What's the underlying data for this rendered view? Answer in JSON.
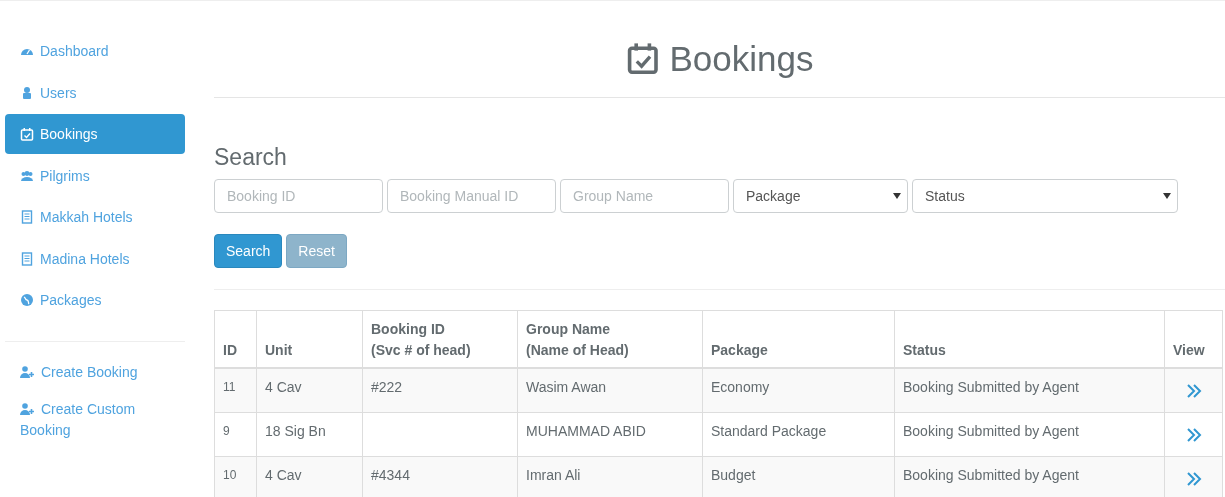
{
  "sidebar": {
    "items": [
      {
        "label": "Dashboard",
        "selected": false
      },
      {
        "label": "Users",
        "selected": false
      },
      {
        "label": "Bookings",
        "selected": true
      },
      {
        "label": "Pilgrims",
        "selected": false
      },
      {
        "label": "Makkah Hotels",
        "selected": false
      },
      {
        "label": "Madina Hotels",
        "selected": false
      },
      {
        "label": "Packages",
        "selected": false
      }
    ],
    "actions": [
      {
        "label": "Create Booking"
      },
      {
        "label": "Create Custom Booking"
      }
    ]
  },
  "page_title": "Bookings",
  "search": {
    "title": "Search",
    "filters": [
      {
        "kind": "text",
        "placeholder": "Booking ID"
      },
      {
        "kind": "text",
        "placeholder": "Booking Manual ID"
      },
      {
        "kind": "text",
        "placeholder": "Group Name"
      },
      {
        "kind": "select",
        "value": "Package"
      },
      {
        "kind": "select",
        "value": "Status"
      }
    ],
    "buttons": [
      {
        "label": "Search",
        "kind": "primary"
      },
      {
        "label": "Reset",
        "kind": "secondary"
      }
    ]
  },
  "table": {
    "columns": [
      {
        "label": "ID"
      },
      {
        "label": "Unit"
      },
      {
        "label": "Booking ID\n(Svc # of head)"
      },
      {
        "label": "Group Name\n(Name of Head)"
      },
      {
        "label": "Package"
      },
      {
        "label": "Status"
      },
      {
        "label": "View"
      }
    ],
    "rows": [
      {
        "cells": [
          "11",
          "4 Cav",
          "#222",
          "Wasim Awan",
          "Economy",
          "Booking Submitted by Agent"
        ]
      },
      {
        "cells": [
          "9",
          "18 Sig Bn",
          "",
          "MUHAMMAD ABID",
          "Standard Package",
          "Booking Submitted by Agent"
        ]
      },
      {
        "cells": [
          "10",
          "4 Cav",
          "#4344",
          "Imran Ali",
          "Budget",
          "Booking Submitted by Agent"
        ]
      }
    ]
  }
}
